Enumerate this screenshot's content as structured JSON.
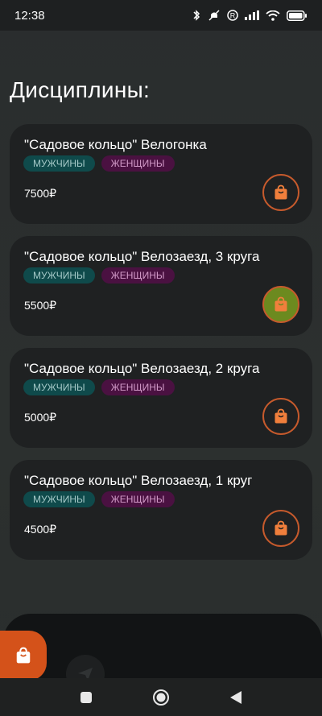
{
  "status_bar": {
    "time": "12:38",
    "icons": [
      "bluetooth-icon",
      "mute-icon",
      "registered-icon",
      "signal-icon",
      "wifi-icon",
      "battery-icon"
    ]
  },
  "page": {
    "title": "Дисциплины:"
  },
  "disciplines": [
    {
      "title": "\"Садовое кольцо\" Велогонка",
      "tag_men": "МУЖЧИНЫ",
      "tag_women": "ЖЕНЩИНЫ",
      "price": "7500₽",
      "in_cart": false
    },
    {
      "title": "\"Садовое кольцо\" Велозаезд, 3 круга",
      "tag_men": "МУЖЧИНЫ",
      "tag_women": "ЖЕНЩИНЫ",
      "price": "5500₽",
      "in_cart": true
    },
    {
      "title": "\"Садовое кольцо\" Велозаезд, 2 круга",
      "tag_men": "МУЖЧИНЫ",
      "tag_women": "ЖЕНЩИНЫ",
      "price": "5000₽",
      "in_cart": false
    },
    {
      "title": "\"Садовое кольцо\" Велозаезд, 1 круг",
      "tag_men": "МУЖЧИНЫ",
      "tag_women": "ЖЕНЩИНЫ",
      "price": "4500₽",
      "in_cart": false
    }
  ],
  "colors": {
    "accent_orange": "#f07f3c",
    "cart_active": "#6c8a1f",
    "tag_men_bg": "#0f4a4b",
    "tag_women_bg": "#4a1141"
  },
  "bottom": {
    "fab_icon": "shopping-bag-icon",
    "secondary_icon": "send-icon"
  },
  "nav": {
    "buttons": [
      "recent-apps-icon",
      "home-icon",
      "back-icon"
    ]
  }
}
